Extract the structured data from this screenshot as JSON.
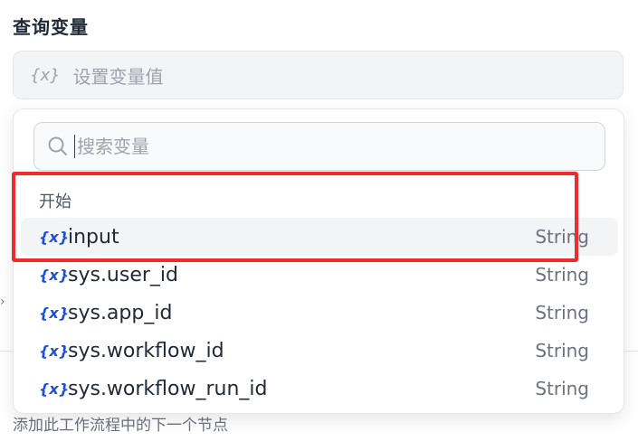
{
  "panel": {
    "title": "查询变量",
    "selector_placeholder": "设置变量值",
    "selector_icon": "{x}"
  },
  "dropdown": {
    "search_placeholder": "搜索变量",
    "group_label": "开始",
    "variables": [
      {
        "icon": "{x}",
        "name": "input",
        "type": "String"
      },
      {
        "icon": "{x}",
        "name": "sys.user_id",
        "type": "String"
      },
      {
        "icon": "{x}",
        "name": "sys.app_id",
        "type": "String"
      },
      {
        "icon": "{x}",
        "name": "sys.workflow_id",
        "type": "String"
      },
      {
        "icon": "{x}",
        "name": "sys.workflow_run_id",
        "type": "String"
      }
    ]
  },
  "background": {
    "next_step_hint": "添加此工作流程中的下一个节点"
  },
  "colors": {
    "variable_icon": "#1d4ed8",
    "annotation": "#ef2b2b",
    "highlight_row": "#f3f4f6"
  }
}
